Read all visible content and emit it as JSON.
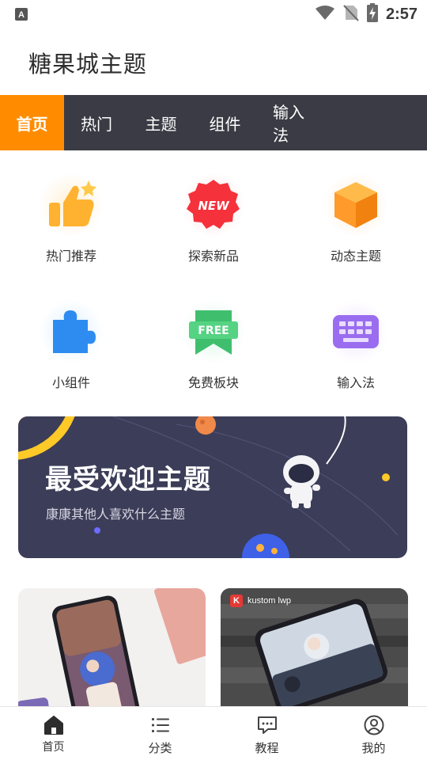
{
  "status_bar": {
    "time": "2:57",
    "icons": [
      "a-notification-icon",
      "wifi-icon",
      "no-sim-icon",
      "battery-charging-icon"
    ]
  },
  "app": {
    "title": "糖果城主题"
  },
  "tabs": [
    {
      "label": "首页",
      "active": true
    },
    {
      "label": "热门",
      "active": false
    },
    {
      "label": "主题",
      "active": false
    },
    {
      "label": "组件",
      "active": false
    },
    {
      "label": "输入法",
      "active": false
    }
  ],
  "categories": [
    {
      "label": "热门推荐",
      "icon": "thumbs-up-icon"
    },
    {
      "label": "探索新品",
      "icon": "new-badge-icon",
      "badge_text": "NEW"
    },
    {
      "label": "动态主题",
      "icon": "cube-icon"
    },
    {
      "label": "小组件",
      "icon": "puzzle-icon"
    },
    {
      "label": "免费板块",
      "icon": "free-ribbon-icon",
      "badge_text": "FREE"
    },
    {
      "label": "输入法",
      "icon": "keyboard-icon"
    }
  ],
  "banner": {
    "title": "最受欢迎主题",
    "subtitle": "康康其他人喜欢什么主题"
  },
  "cards": {
    "right_badge": "kustom lwp"
  },
  "bottom_nav": [
    {
      "label": "首页",
      "icon": "home-icon",
      "active": true
    },
    {
      "label": "分类",
      "icon": "list-icon",
      "active": false
    },
    {
      "label": "教程",
      "icon": "tutorial-chat-icon",
      "active": false
    },
    {
      "label": "我的",
      "icon": "user-icon",
      "active": false
    }
  ],
  "colors": {
    "accent": "#ff8c00",
    "tab_bar": "#3b3b45",
    "banner_bg": "#3c3d58"
  }
}
